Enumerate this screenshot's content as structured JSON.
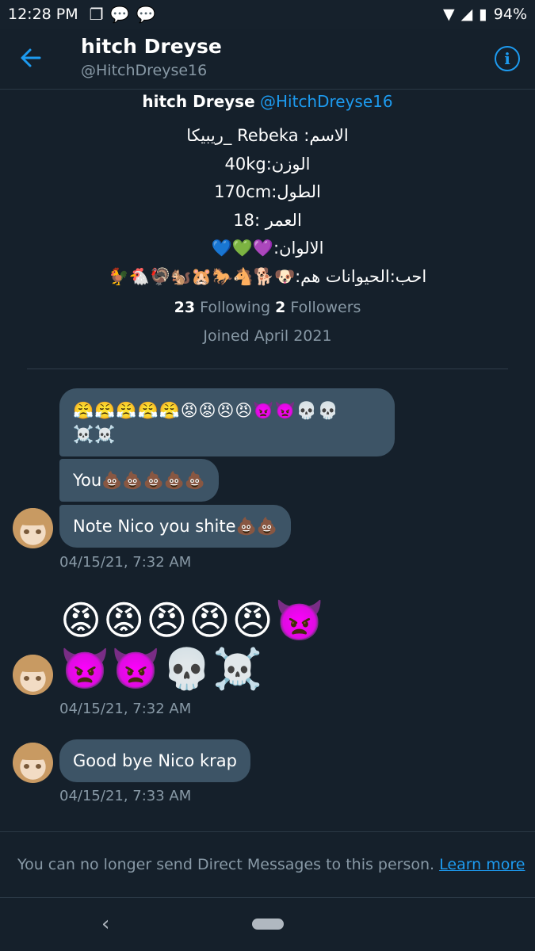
{
  "status": {
    "time": "12:28 PM",
    "battery": "94%",
    "icons_left": [
      "recent-apps-icon",
      "chat-bubble-icon",
      "chat-bubble-icon"
    ],
    "icons_right": [
      "wifi-icon",
      "signal-icon",
      "battery-icon"
    ]
  },
  "header": {
    "name": "hitch Dreyse",
    "handle": "@HitchDreyse16"
  },
  "profile": {
    "name": "hitch Dreyse",
    "handle": "@HitchDreyse16",
    "bio": [
      "الاسم: Rebeka _ريبيكا",
      "الوزن:40kg",
      "الطول:170cm",
      "العمر :18",
      "الالوان:💜💚💙",
      "احب:الحيوانات هم:🐶🐕🐴🐎🐹🐿️🦃🐔🐓"
    ],
    "following_count": "23",
    "following_label": "Following",
    "followers_count": "2",
    "followers_label": "Followers",
    "joined": "Joined April 2021"
  },
  "messages": {
    "m1": "😤😤😤😤😤😡😡😠😠👿👿💀💀☠️☠️",
    "m2": "You💩💩💩💩💩",
    "m3": "Note Nico you shite💩💩",
    "ts1": "04/15/21, 7:32 AM",
    "emoji_row1": "😡😡😠😠😠👿",
    "emoji_row2": "👿👿💀☠️",
    "ts2": "04/15/21, 7:32 AM",
    "m4": "Good bye Nico krap",
    "ts3": "04/15/21, 7:33 AM"
  },
  "footer": {
    "text": "You can no longer send Direct Messages to this person.",
    "link": "Learn more"
  },
  "colors": {
    "background": "#15202b",
    "bubble": "#3d5466",
    "accent": "#1d9bf0",
    "muted": "#8899a6"
  }
}
